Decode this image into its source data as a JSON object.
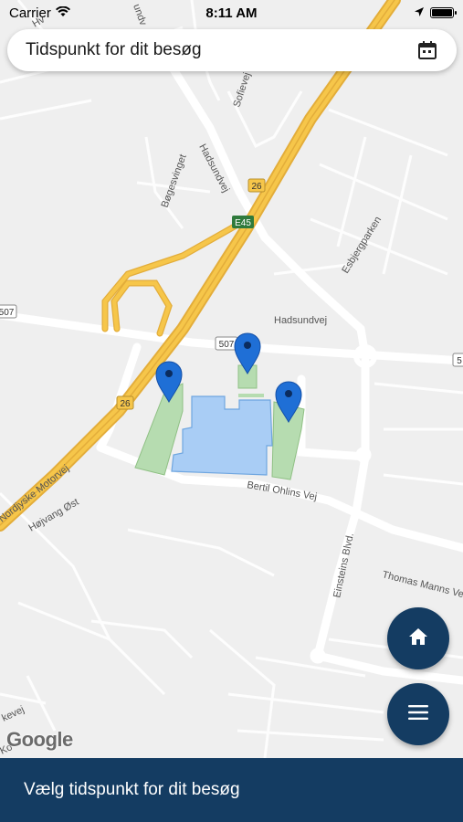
{
  "status_bar": {
    "carrier": "Carrier",
    "time": "8:11 AM"
  },
  "search": {
    "label": "Tidspunkt for dit besøg",
    "icon": "calendar-icon"
  },
  "map": {
    "street_labels": {
      "hadsundvej_north": "Hadsundvej",
      "hadsundvej_east": "Hadsundvej",
      "sofievej": "Sofievej",
      "bogesvinget": "Bøgesvinget",
      "esbjergparken": "Esbjergparken",
      "nordjyske_motorvej": "Nordjyske Motorvej",
      "hojvang_ost": "Højvang Øst",
      "bertil_ohlins_vej": "Bertil Ohlins Vej",
      "einsteins_blvd": "Einsteins Blvd.",
      "thomas_manns_vej": "Thomas Manns Ve",
      "lundvej_partial": "undv",
      "kevej_partial": "kevej",
      "ko_partial": "Ko",
      "top_left_partial": "Hv"
    },
    "road_shields": {
      "r26_top": "26",
      "e45": "E45",
      "r507_left": "507",
      "r507_mid": "507",
      "r507_right": "5",
      "r26_bottom": "26"
    },
    "pin_color": "#1f6fd6",
    "building_color": "#a9cdf5",
    "parking_color": "#b6dcb0",
    "motorway_color": "#f6c64a"
  },
  "fabs": {
    "home_icon": "home-icon",
    "menu_icon": "menu-icon",
    "color": "#143c62"
  },
  "attribution": "Google",
  "bottom_bar": {
    "label": "Vælg tidspunkt for dit besøg",
    "color": "#143c62"
  }
}
